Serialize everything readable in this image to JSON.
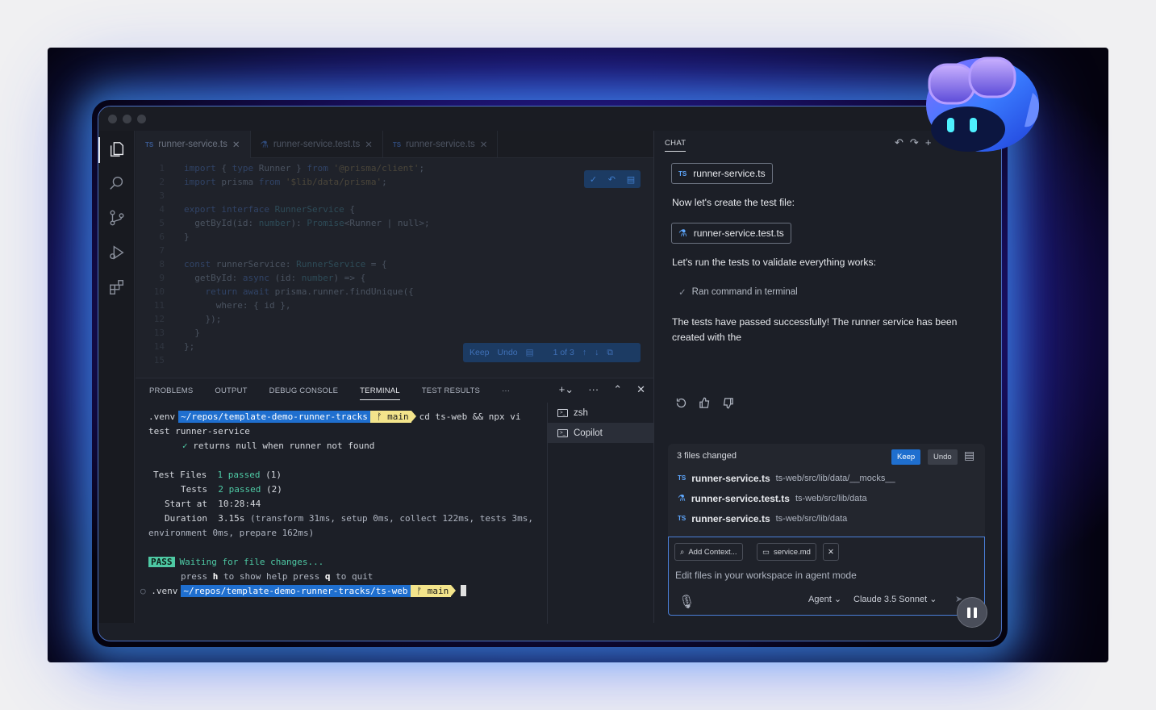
{
  "editor": {
    "tabs": [
      {
        "label": "runner-service.ts",
        "icon": "ts"
      },
      {
        "label": "runner-service.test.ts",
        "icon": "flask"
      },
      {
        "label": "runner-service.ts",
        "icon": "ts"
      }
    ],
    "code": [
      {
        "n": "1",
        "t": "import { type Runner } from '@prisma/client';"
      },
      {
        "n": "2",
        "t": "import prisma from '$lib/data/prisma';"
      },
      {
        "n": "3",
        "t": ""
      },
      {
        "n": "4",
        "t": "export interface RunnerService {"
      },
      {
        "n": "5",
        "t": "  getById(id: number): Promise<Runner | null>;"
      },
      {
        "n": "6",
        "t": "}"
      },
      {
        "n": "7",
        "t": ""
      },
      {
        "n": "8",
        "t": "const runnerService: RunnerService = {"
      },
      {
        "n": "9",
        "t": "  getById: async (id: number) => {"
      },
      {
        "n": "10",
        "t": "    return await prisma.runner.findUnique({"
      },
      {
        "n": "11",
        "t": "      where: { id },"
      },
      {
        "n": "12",
        "t": "    });"
      },
      {
        "n": "13",
        "t": "  }"
      },
      {
        "n": "14",
        "t": "};"
      },
      {
        "n": "15",
        "t": ""
      }
    ],
    "keep_bar": {
      "keep": "Keep",
      "undo": "Undo",
      "count": "1 of 3"
    }
  },
  "panel": {
    "tabs": [
      "PROBLEMS",
      "OUTPUT",
      "DEBUG CONSOLE",
      "TERMINAL",
      "TEST RESULTS"
    ],
    "active_tab": "TERMINAL",
    "terminal": {
      "venv": ".venv",
      "path1": "~/repos/template-demo-runner-tracks",
      "branch": "main",
      "cmd1": "cd ts-web && npx vi",
      "cmd1_cont": "test runner-service",
      "check_line": "returns null when runner not found",
      "test_files_label": "Test Files",
      "test_files_val": "1 passed",
      "test_files_count": "(1)",
      "tests_label": "Tests",
      "tests_val": "2 passed",
      "tests_count": "(2)",
      "start_label": "Start at",
      "start_val": "10:28:44",
      "duration_label": "Duration",
      "duration_val": "3.15s",
      "duration_rest": "(transform 31ms, setup 0ms, collect 122ms, tests 3ms,",
      "duration_rest2": "environment 0ms, prepare 162ms)",
      "pass_badge": "PASS",
      "waiting": "Waiting for file changes...",
      "help_line": {
        "a": "press ",
        "h": "h",
        "b": " to show help press ",
        "q": "q",
        "c": " to quit"
      },
      "path2": "~/repos/template-demo-runner-tracks/ts-web"
    },
    "terminals": [
      "zsh",
      "Copilot"
    ]
  },
  "chat": {
    "title": "CHAT",
    "file_chip_1": "runner-service.ts",
    "msg1": "Now let's create the test file:",
    "file_chip_2": "runner-service.test.ts",
    "msg2": "Let's run the tests to validate everything works:",
    "ran": "Ran command in terminal",
    "msg3": "The tests have passed successfully! The runner service has been created with the",
    "changes": {
      "title": "3 files changed",
      "keep": "Keep",
      "undo": "Undo",
      "files": [
        {
          "name": "runner-service.ts",
          "path": "ts-web/src/lib/data/__mocks__",
          "icon": "ts"
        },
        {
          "name": "runner-service.test.ts",
          "path": "ts-web/src/lib/data",
          "icon": "flask"
        },
        {
          "name": "runner-service.ts",
          "path": "ts-web/src/lib/data",
          "icon": "ts"
        }
      ]
    },
    "input": {
      "add_context": "Add Context...",
      "context_file": "service.md",
      "placeholder": "Edit files in your workspace in agent mode",
      "mode": "Agent",
      "model": "Claude 3.5 Sonnet"
    }
  },
  "colors": {
    "accent": "#1f6fcf",
    "pass": "#4ec9a4",
    "branch": "#f3e48b"
  }
}
